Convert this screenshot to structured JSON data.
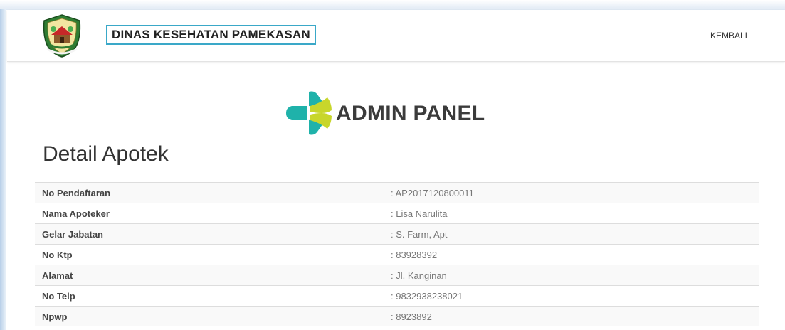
{
  "header": {
    "brand": "DINAS KESEHATAN PAMEKASAN",
    "back_label": "KEMBALI"
  },
  "logo": {
    "text": "ADMIN PANEL",
    "colors": {
      "teal": "#1fb2aa",
      "lime": "#c8d62b"
    }
  },
  "page": {
    "title": "Detail Apotek"
  },
  "details": [
    {
      "label": "No Pendaftaran",
      "value": ": AP2017120800011"
    },
    {
      "label": "Nama Apoteker",
      "value": ": Lisa Narulita"
    },
    {
      "label": "Gelar Jabatan",
      "value": ": S. Farm, Apt"
    },
    {
      "label": "No Ktp",
      "value": ": 83928392"
    },
    {
      "label": "Alamat",
      "value": ": Jl. Kanginan"
    },
    {
      "label": "No Telp",
      "value": ": 9832938238021"
    },
    {
      "label": "Npwp",
      "value": ": 8923892"
    }
  ],
  "colors": {
    "brand_border": "#3aa8c8",
    "text_dark": "#333333",
    "text_muted": "#777777",
    "row_stripe": "#f9f9f9"
  }
}
